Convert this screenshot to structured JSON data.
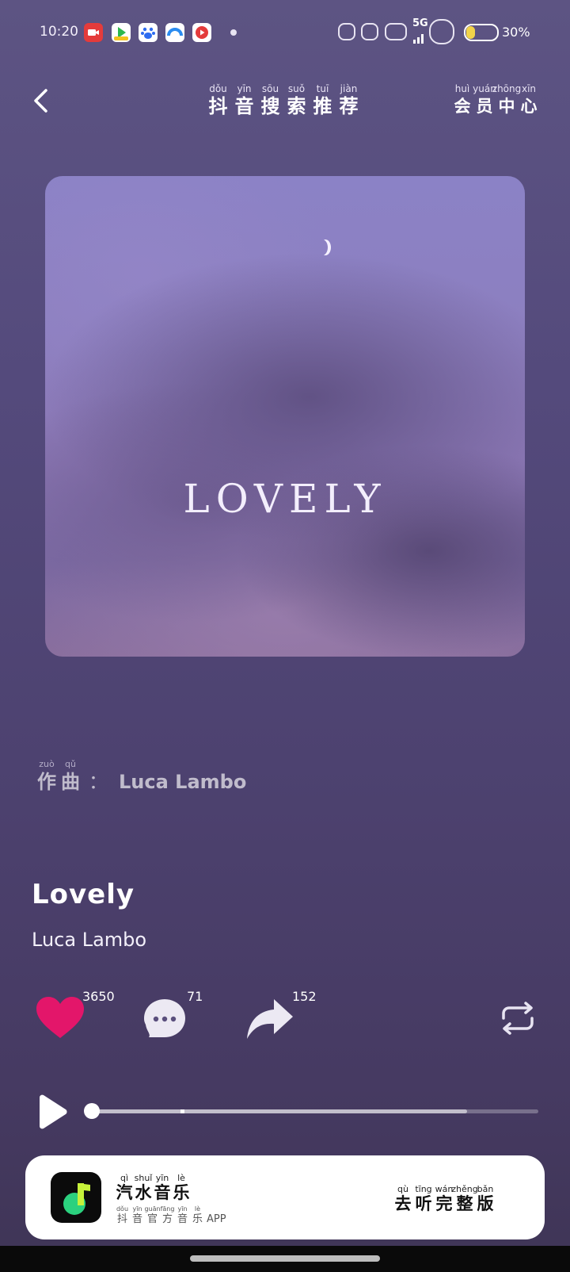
{
  "status_bar": {
    "time": "10:20",
    "network": "5G",
    "battery_percent": "30%",
    "battery_level": 0.3,
    "notification_icons": [
      "screen-record-icon",
      "video-app-icon",
      "baidu-icon",
      "browser-icon",
      "video-play-icon"
    ]
  },
  "header": {
    "title_chars": [
      {
        "py": "dǒu",
        "c": "抖"
      },
      {
        "py": "yīn",
        "c": "音"
      },
      {
        "py": "sōu",
        "c": "搜"
      },
      {
        "py": "suǒ",
        "c": "索"
      },
      {
        "py": "tuī",
        "c": "推"
      },
      {
        "py": "jiàn",
        "c": "荐"
      }
    ],
    "member_chars": [
      {
        "py": "huì",
        "c": "会"
      },
      {
        "py": "yuán",
        "c": "员"
      },
      {
        "py": "zhōng",
        "c": "中"
      },
      {
        "py": "xīn",
        "c": "心"
      }
    ]
  },
  "cover": {
    "title": "LOVELY"
  },
  "composer": {
    "label_chars": [
      {
        "py": "zuò",
        "c": "作"
      },
      {
        "py": "qǔ",
        "c": "曲"
      }
    ],
    "separator": "：",
    "name": "Luca Lambo"
  },
  "song": {
    "title": "Lovely",
    "artist": "Luca Lambo"
  },
  "actions": {
    "likes": "3650",
    "comments": "71",
    "shares": "152"
  },
  "player": {
    "progress": 0.0,
    "buffered": 0.84
  },
  "banner": {
    "app_chars": [
      {
        "py": "qì",
        "c": "汽"
      },
      {
        "py": "shuǐ",
        "c": "水"
      },
      {
        "py": "yīn",
        "c": "音"
      },
      {
        "py": "lè",
        "c": "乐"
      }
    ],
    "sub_chars": [
      {
        "py": "dǒu",
        "c": "抖"
      },
      {
        "py": "yīn",
        "c": "音"
      },
      {
        "py": "guān",
        "c": "官"
      },
      {
        "py": "fāng",
        "c": "方"
      },
      {
        "py": "yīn",
        "c": "音"
      },
      {
        "py": "lè",
        "c": "乐"
      }
    ],
    "sub_tail": "APP",
    "cta_chars": [
      {
        "py": "qù",
        "c": "去"
      },
      {
        "py": "tīng",
        "c": "听"
      },
      {
        "py": "wán",
        "c": "完"
      },
      {
        "py": "zhěng",
        "c": "整"
      },
      {
        "py": "bǎn",
        "c": "版"
      }
    ]
  },
  "colors": {
    "like": "#e3166a",
    "accent_green": "#2bd17e"
  }
}
